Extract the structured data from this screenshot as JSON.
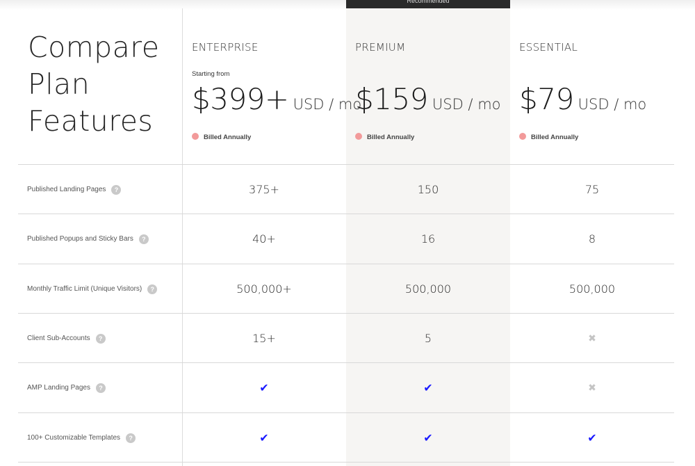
{
  "header": {
    "recommended_label": "Recommended",
    "title_lines": [
      "Compare",
      "Plan",
      "Features"
    ]
  },
  "plans": [
    {
      "name": "ENTERPRISE",
      "starting_label": "Starting from",
      "price": "$399+",
      "unit": "USD / mo",
      "billing": "Billed Annually"
    },
    {
      "name": "PREMIUM",
      "starting_label": "",
      "price": "$159",
      "unit": "USD / mo",
      "billing": "Billed Annually"
    },
    {
      "name": "ESSENTIAL",
      "starting_label": "",
      "price": "$79",
      "unit": "USD / mo",
      "billing": "Billed Annually"
    }
  ],
  "help_glyph": "?",
  "icons": {
    "included": "check-icon",
    "not_included": "x-icon"
  },
  "colors": {
    "check": "#1a1aff",
    "cross": "#c4c4c4",
    "billing_dot": "#f29a9a",
    "recommended_column": "#f6f5f3"
  },
  "features": [
    {
      "label": "Published Landing Pages",
      "values": [
        "375+",
        "150",
        "75"
      ]
    },
    {
      "label": "Published Popups and Sticky Bars",
      "values": [
        "40+",
        "16",
        "8"
      ]
    },
    {
      "label": "Monthly Traffic Limit (Unique Visitors)",
      "values": [
        "500,000+",
        "500,000",
        "500,000"
      ]
    },
    {
      "label": "Client Sub-Accounts",
      "values": [
        "15+",
        "5",
        "✖"
      ]
    },
    {
      "label": "AMP Landing Pages",
      "values": [
        "✔",
        "✔",
        "✖"
      ]
    },
    {
      "label": "100+ Customizable Templates",
      "values": [
        "✔",
        "✔",
        "✔"
      ]
    }
  ]
}
